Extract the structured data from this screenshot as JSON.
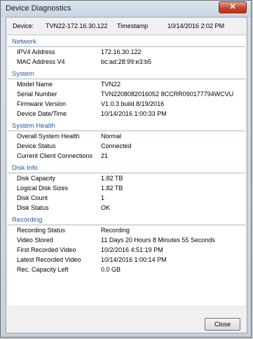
{
  "window": {
    "title": "Device Diagnostics",
    "close_glyph": "✕"
  },
  "header": {
    "device_label": "Device:",
    "device_value": "TVN22-172.16.30.122",
    "timestamp_label": "Timestamp",
    "timestamp_value": "10/14/2016 2:02 PM"
  },
  "sections": [
    {
      "title": "Network",
      "rows": [
        {
          "label": "IPV4 Address",
          "value": "172.16.30.122"
        },
        {
          "label": "MAC Address V4",
          "value": "bc:ad:28:99:e3:b5"
        }
      ]
    },
    {
      "title": "System",
      "rows": [
        {
          "label": "Model Name",
          "value": "TVN22"
        },
        {
          "label": "Serial Number",
          "value": "TVN2208082016052 8CCRR090177794WCVU"
        },
        {
          "label": "Firmware Version",
          "value": "V1.0.3 build 8/19/2016"
        },
        {
          "label": "Device Date/Time",
          "value": "10/14/2016 1:00:33 PM"
        }
      ]
    },
    {
      "title": "System Health",
      "rows": [
        {
          "label": "Overall System Health",
          "value": "Normal"
        },
        {
          "label": "Device Status",
          "value": "Connected"
        },
        {
          "label": "Current Client Connections",
          "value": "21"
        }
      ]
    },
    {
      "title": "Disk Info",
      "rows": [
        {
          "label": "Disk Capacity",
          "value": "1.82 TB"
        },
        {
          "label": "Logical Disk Sizes",
          "value": "1.82 TB"
        },
        {
          "label": "Disk Count",
          "value": "1"
        },
        {
          "label": "Disk Status",
          "value": "OK"
        }
      ]
    },
    {
      "title": "Recording",
      "rows": [
        {
          "label": "Recording Status",
          "value": "Recording"
        },
        {
          "label": "Video Stored",
          "value": "11 Days 20 Hours 8 Minutes 55 Seconds"
        },
        {
          "label": "First Recorded Video",
          "value": "10/2/2016 4:51:19 PM"
        },
        {
          "label": "Latest Recorded Video",
          "value": "10/14/2016 1:00:14 PM"
        },
        {
          "label": "Rec. Capacity Left",
          "value": "0.0 GB"
        }
      ]
    }
  ],
  "footer": {
    "close_label": "Close"
  }
}
